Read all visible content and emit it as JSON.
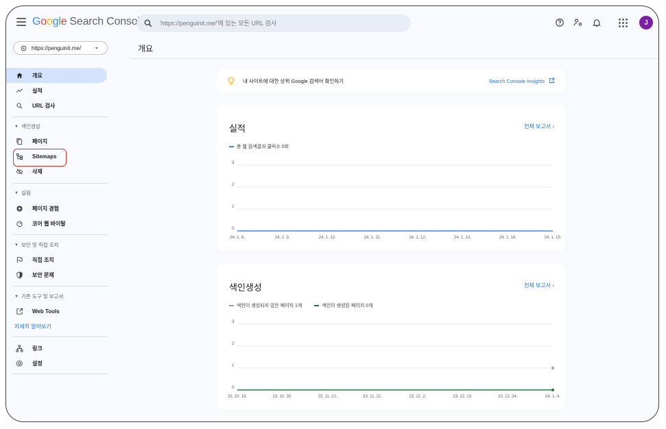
{
  "app": {
    "logo_google": [
      "G",
      "o",
      "o",
      "g",
      "l",
      "e"
    ],
    "logo_product": "Search Console"
  },
  "search": {
    "placeholder": "'https://penguinit.me/'에 있는 모든 URL 검사"
  },
  "user": {
    "avatar_letter": "J",
    "avatar_color": "#7b1fa2"
  },
  "property": {
    "selected": "https://penguinit.me/"
  },
  "sidebar": {
    "top_items": [
      {
        "label": "개요",
        "icon": "home-icon",
        "active": true
      },
      {
        "label": "실적",
        "icon": "trending-icon"
      },
      {
        "label": "URL 검사",
        "icon": "search-icon"
      }
    ],
    "sections": [
      {
        "title": "색인생성",
        "items": [
          {
            "label": "페이지",
            "icon": "pages-icon"
          },
          {
            "label": "Sitemaps",
            "icon": "sitemap-icon"
          },
          {
            "label": "삭제",
            "icon": "removal-icon"
          }
        ]
      },
      {
        "title": "실험",
        "items": [
          {
            "label": "페이지 경험",
            "icon": "page-experience-icon"
          },
          {
            "label": "코어 웹 바이탈",
            "icon": "gauge-icon"
          }
        ]
      },
      {
        "title": "보안 및 직접 조치",
        "items": [
          {
            "label": "직접 조치",
            "icon": "flag-icon"
          },
          {
            "label": "보안 문제",
            "icon": "shield-icon"
          }
        ]
      },
      {
        "title": "기존 도구 및 보고서",
        "items": [
          {
            "label": "Web Tools",
            "icon": "external-icon"
          }
        ]
      }
    ],
    "learn_more": "자세히 알아보기",
    "bottom_items": [
      {
        "label": "링크",
        "icon": "links-icon"
      },
      {
        "label": "설정",
        "icon": "settings-icon"
      }
    ]
  },
  "main": {
    "title": "개요",
    "insight": {
      "text": "내 사이트에 대한 상위 Google 검색어 확인하기",
      "link": "Search Console Insights"
    }
  },
  "colors": {
    "accent": "#1a73e8",
    "series_blue": "#4285f4",
    "series_gray": "#9aa0a6",
    "series_green": "#188038",
    "highlight": "#d93025"
  },
  "chart_data": [
    {
      "type": "line",
      "title": "실적",
      "report_link": "전체 보고서",
      "x": [
        "24. 1. 8.",
        "24. 1. 9.",
        "24. 1. 10.",
        "24. 1. 11.",
        "24. 1. 12.",
        "24. 1. 13.",
        "24. 1. 14.",
        "24. 1. 15."
      ],
      "series": [
        {
          "name": "총 웹 검색결과 클릭수 0회",
          "values": [
            0,
            0,
            0,
            0,
            0,
            0,
            0,
            0
          ],
          "color": "#4285f4"
        }
      ],
      "ylim": [
        0,
        3
      ],
      "yticks": [
        "0",
        "1",
        "2",
        "3"
      ],
      "grid": true
    },
    {
      "type": "line",
      "title": "색인생성",
      "report_link": "전체 보고서",
      "x": [
        "23. 10. 19.",
        "23. 10. 30.",
        "23. 11. 10.",
        "23. 11. 21.",
        "23. 12. 2.",
        "23. 12. 13.",
        "23. 12. 24.",
        "24. 1. 4."
      ],
      "series": [
        {
          "name": "색인이 생성되지 않은 페이지 1개",
          "values": [
            null,
            null,
            null,
            null,
            null,
            null,
            null,
            1
          ],
          "color": "#9aa0a6"
        },
        {
          "name": "색인이 생성된 페이지 0개",
          "values": [
            0,
            0,
            0,
            0,
            0,
            0,
            0,
            0
          ],
          "color": "#188038"
        }
      ],
      "ylim": [
        0,
        3
      ],
      "yticks": [
        "0",
        "1",
        "2",
        "3"
      ],
      "grid": true
    }
  ]
}
